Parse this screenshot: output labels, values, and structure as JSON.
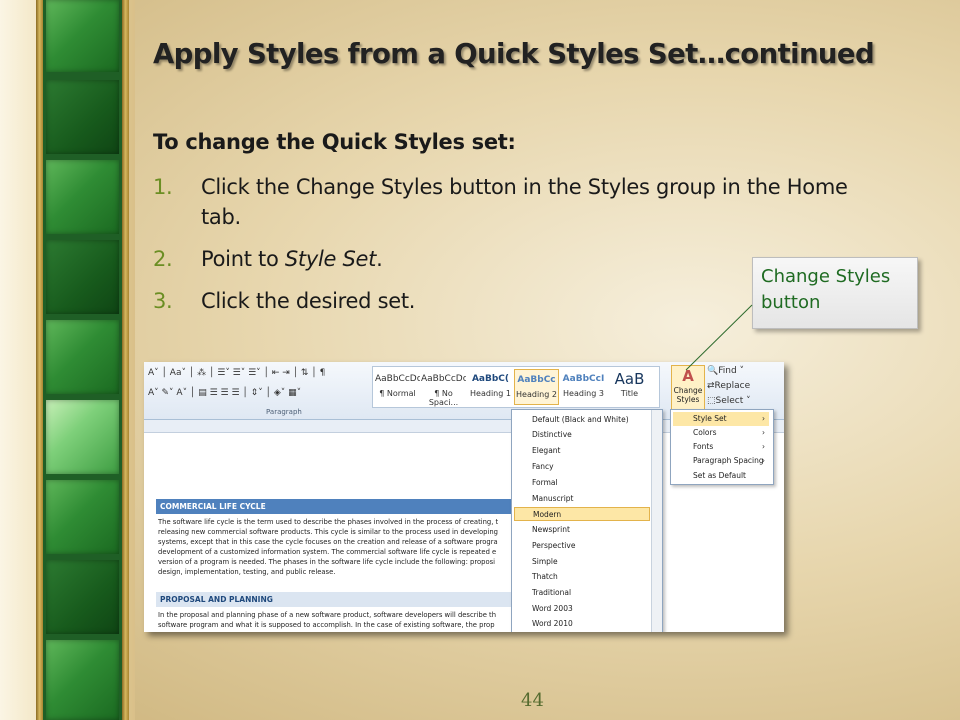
{
  "slide": {
    "title": "Apply Styles from a Quick Styles Set…continued",
    "subheading": "To change the Quick Styles set:",
    "steps": [
      {
        "num": "1.",
        "text": "Click the Change Styles button in the Styles group in the Home tab."
      },
      {
        "num": "2.",
        "text_before": "Point to ",
        "text_italic": "Style Set",
        "text_after": "."
      },
      {
        "num": "3.",
        "text": "Click the desired set."
      }
    ],
    "callout": "Change Styles button",
    "page_number": "44"
  },
  "screenshot": {
    "paragraph_group_label": "Paragraph",
    "style_gallery": [
      {
        "preview": "AaBbCcDc",
        "label": "¶ Normal"
      },
      {
        "preview": "AaBbCcDc",
        "label": "¶ No Spaci..."
      },
      {
        "preview": "AaBbC(",
        "label": "Heading 1"
      },
      {
        "preview": "AaBbCc",
        "label": "Heading 2"
      },
      {
        "preview": "AaBbCcI",
        "label": "Heading 3"
      },
      {
        "preview": "AaB",
        "label": "Title"
      }
    ],
    "change_styles": {
      "line1": "Change",
      "line2": "Styles"
    },
    "editing": {
      "find": "Find",
      "replace": "Replace",
      "select": "Select"
    },
    "submenu": [
      "Style Set",
      "Colors",
      "Fonts",
      "Paragraph Spacing",
      "Set as Default"
    ],
    "style_sets": [
      "Default (Black and White)",
      "Distinctive",
      "Elegant",
      "Fancy",
      "Formal",
      "Manuscript",
      "Modern",
      "Newsprint",
      "Perspective",
      "Simple",
      "Thatch",
      "Traditional",
      "Word 2003",
      "Word 2010"
    ],
    "highlighted_set": "Modern",
    "doc": {
      "heading1": "COMMERCIAL LIFE CYCLE",
      "para1": "The software life cycle is the term used to describe the phases involved in the process of creating, t releasing new commercial software products. This cycle is similar to the process used in developing systems, except that in this case the cycle focuses on the creation and release of a software progra development of a customized information system. The commercial software life cycle is repeated e version of a program is needed. The phases in the software life cycle include the following: proposi design, implementation, testing, and public release.",
      "heading2": "PROPOSAL AND PLANNING",
      "para2": "In the proposal and planning phase of a new software product, software developers will describe th software program and what it is supposed to accomplish. In the case of existing software, the prop"
    }
  },
  "colors": {
    "accent_green": "#6b8e23",
    "callout_text": "#1f6b22",
    "heading_blue": "#4f81bd"
  }
}
